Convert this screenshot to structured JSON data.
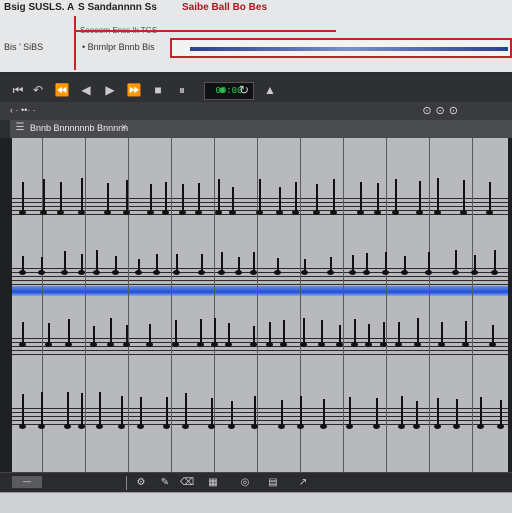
{
  "topbar": {
    "title": "Bsig SUSLS. A",
    "title2": "S Sandannnn Ss",
    "title3": "Saibe Ball Bo Bes",
    "left_label": "Bis ’ SiBS",
    "mid_label": "• Bnmlpr Bnnb Bis",
    "subinfo": "Soooorn Enss Ik TGS"
  },
  "toolbar": {
    "counter": "00:00",
    "buttons": [
      "⏮",
      "↶",
      "⏪",
      "◀",
      "▶",
      "⏩",
      "⏺",
      "■",
      "⏸",
      "↻"
    ]
  },
  "subbar": {
    "label": "‹ · ••· ·",
    "right": "⊙⊙⊙"
  },
  "panelbar": {
    "label": "Bnnb Bnnnnnnb Bnnnnn"
  },
  "status": {
    "text": ""
  },
  "colors": {
    "accent_red": "#c02828",
    "record_green": "#2fb84a",
    "lane_blue": "#1e4fd6",
    "score_bg": "#b7b9bd",
    "app_dark": "#2c2d30"
  }
}
